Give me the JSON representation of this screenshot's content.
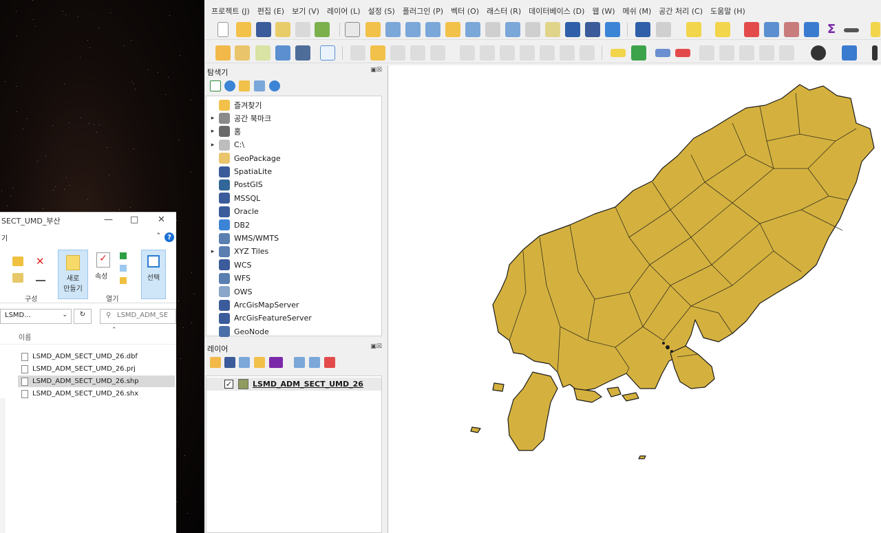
{
  "explorer": {
    "title_fragment": "SECT_UMD_부산",
    "ribbon_tab_fragment": "기",
    "new_label_line1": "새로",
    "new_label_line2": "만들기",
    "properties_label": "속성",
    "select_label": "선택",
    "group_organize": "구성",
    "group_open": "열기",
    "path_fragment": "LSMD...",
    "search_placeholder": "LSMD_ADM_SE",
    "column_name": "이름",
    "files": [
      "LSMD_ADM_SECT_UMD_26.dbf",
      "LSMD_ADM_SECT_UMD_26.prj",
      "LSMD_ADM_SECT_UMD_26.shp",
      "LSMD_ADM_SECT_UMD_26.shx"
    ]
  },
  "qgis": {
    "menus": [
      "프로젝트 (J)",
      "편집 (E)",
      "보기 (V)",
      "레이어 (L)",
      "설정 (S)",
      "플러그인 (P)",
      "벡터 (O)",
      "래스터 (R)",
      "데이터베이스 (D)",
      "웹 (W)",
      "메쉬 (M)",
      "공간 처리 (C)",
      "도움말 (H)"
    ],
    "browser_panel_title": "탐색기",
    "browser_items": [
      {
        "label": "즐겨찾기",
        "icon": "star-icon",
        "expandable": false
      },
      {
        "label": "공간 북마크",
        "icon": "bookmark-icon",
        "expandable": true
      },
      {
        "label": "홈",
        "icon": "home-icon",
        "expandable": true
      },
      {
        "label": "C:\\",
        "icon": "folder-icon",
        "expandable": true
      },
      {
        "label": "GeoPackage",
        "icon": "geopackage-icon",
        "expandable": false
      },
      {
        "label": "SpatiaLite",
        "icon": "spatialite-icon",
        "expandable": false
      },
      {
        "label": "PostGIS",
        "icon": "postgis-icon",
        "expandable": false
      },
      {
        "label": "MSSQL",
        "icon": "mssql-icon",
        "expandable": false
      },
      {
        "label": "Oracle",
        "icon": "oracle-icon",
        "expandable": false
      },
      {
        "label": "DB2",
        "icon": "db2-icon",
        "expandable": false
      },
      {
        "label": "WMS/WMTS",
        "icon": "wms-icon",
        "expandable": false
      },
      {
        "label": "XYZ Tiles",
        "icon": "xyz-icon",
        "expandable": true
      },
      {
        "label": "WCS",
        "icon": "wcs-icon",
        "expandable": false
      },
      {
        "label": "WFS",
        "icon": "wfs-icon",
        "expandable": false
      },
      {
        "label": "OWS",
        "icon": "ows-icon",
        "expandable": false
      },
      {
        "label": "ArcGisMapServer",
        "icon": "arcgis-map-icon",
        "expandable": false
      },
      {
        "label": "ArcGisFeatureServer",
        "icon": "arcgis-feature-icon",
        "expandable": false
      },
      {
        "label": "GeoNode",
        "icon": "geonode-icon",
        "expandable": false
      }
    ],
    "layers_panel_title": "레이어",
    "layer": {
      "name": "LSMD_ADM_SECT_UMD_26",
      "checked": true,
      "swatch_color": "#8f9b5f"
    },
    "map_fill_color": "#d4b13e"
  }
}
